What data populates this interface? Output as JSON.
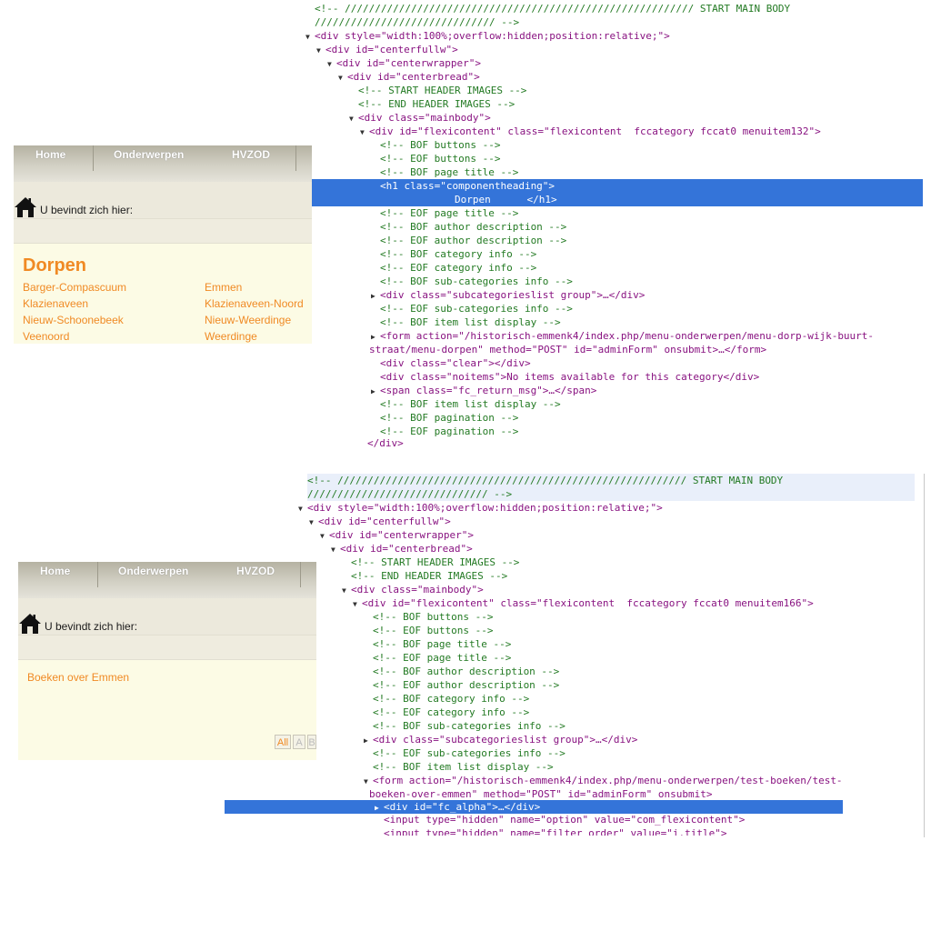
{
  "site_top": {
    "nav": [
      "Home",
      "Onderwerpen",
      "HVZOD"
    ],
    "breadcrumb_label": "U bevindt zich hier:",
    "page_title": "Dorpen",
    "categories": [
      "Barger-Compascuum",
      "Emmen",
      "Klazienaveen",
      "Klazienaveen-Noord",
      "Nieuw-Schoonebeek",
      "Nieuw-Weerdinge",
      "Veenoord",
      "Weerdinge"
    ]
  },
  "site_bottom": {
    "nav": [
      "Home",
      "Onderwerpen",
      "HVZOD"
    ],
    "breadcrumb_label": "U bevindt zich hier:",
    "item_link": "Boeken over Emmen",
    "alpha": [
      "All",
      "A",
      "B"
    ]
  },
  "devtools_top": {
    "lines": [
      "<!-- ////////////////////////////////////////////////////////// START MAIN BODY",
      "////////////////////////////// -->",
      "<div style=\"width:100%;overflow:hidden;position:relative;\">",
      "<div id=\"centerfullw\">",
      "<div id=\"centerwrapper\">",
      "<div id=\"centerbread\">",
      "<!-- START HEADER IMAGES -->",
      "<!-- END HEADER IMAGES -->",
      "<div class=\"mainbody\">",
      "<div id=\"flexicontent\" class=\"flexicontent  fccategory fccat0 menuitem132\">",
      "<!-- BOF buttons -->",
      "<!-- EOF buttons -->",
      "<!-- BOF page title -->",
      "<h1 class=\"componentheading\">",
      "Dorpen      </h1>",
      "<!-- EOF page title -->",
      "<!-- BOF author description -->",
      "<!-- EOF author description -->",
      "<!-- BOF category info -->",
      "<!-- EOF category info -->",
      "<!-- BOF sub-categories info -->",
      "<div class=\"subcategorieslist group\">…</div>",
      "<!-- EOF sub-categories info -->",
      "<!-- BOF item list display -->",
      "<form action=\"/historisch-emmenk4/index.php/menu-onderwerpen/menu-dorp-wijk-buurt-",
      "straat/menu-dorpen\" method=\"POST\" id=\"adminForm\" onsubmit>…</form>",
      "<div class=\"clear\"></div>",
      "<div class=\"noitems\">No items available for this category</div>",
      "<span class=\"fc_return_msg\">…</span>",
      "<!-- BOF item list display -->",
      "<!-- BOF pagination -->",
      "<!-- EOF pagination -->",
      "</div>"
    ]
  },
  "devtools_bottom": {
    "lines": [
      "<!-- ////////////////////////////////////////////////////////// START MAIN BODY",
      "////////////////////////////// -->",
      "<div style=\"width:100%;overflow:hidden;position:relative;\">",
      "<div id=\"centerfullw\">",
      "<div id=\"centerwrapper\">",
      "<div id=\"centerbread\">",
      "<!-- START HEADER IMAGES -->",
      "<!-- END HEADER IMAGES -->",
      "<div class=\"mainbody\">",
      "<div id=\"flexicontent\" class=\"flexicontent  fccategory fccat0 menuitem166\">",
      "<!-- BOF buttons -->",
      "<!-- EOF buttons -->",
      "<!-- BOF page title -->",
      "<!-- EOF page title -->",
      "<!-- BOF author description -->",
      "<!-- EOF author description -->",
      "<!-- BOF category info -->",
      "<!-- EOF category info -->",
      "<!-- BOF sub-categories info -->",
      "<div class=\"subcategorieslist group\">…</div>",
      "<!-- EOF sub-categories info -->",
      "<!-- BOF item list display -->",
      "<form action=\"/historisch-emmenk4/index.php/menu-onderwerpen/test-boeken/test-",
      "boeken-over-emmen\" method=\"POST\" id=\"adminForm\" onsubmit>",
      "<div id=\"fc_alpha\">…</div>",
      "<input type=\"hidden\" name=\"option\" value=\"com_flexicontent\">",
      "<input type=\"hidden\" name=\"filter_order\" value=\"i.title\">"
    ]
  }
}
